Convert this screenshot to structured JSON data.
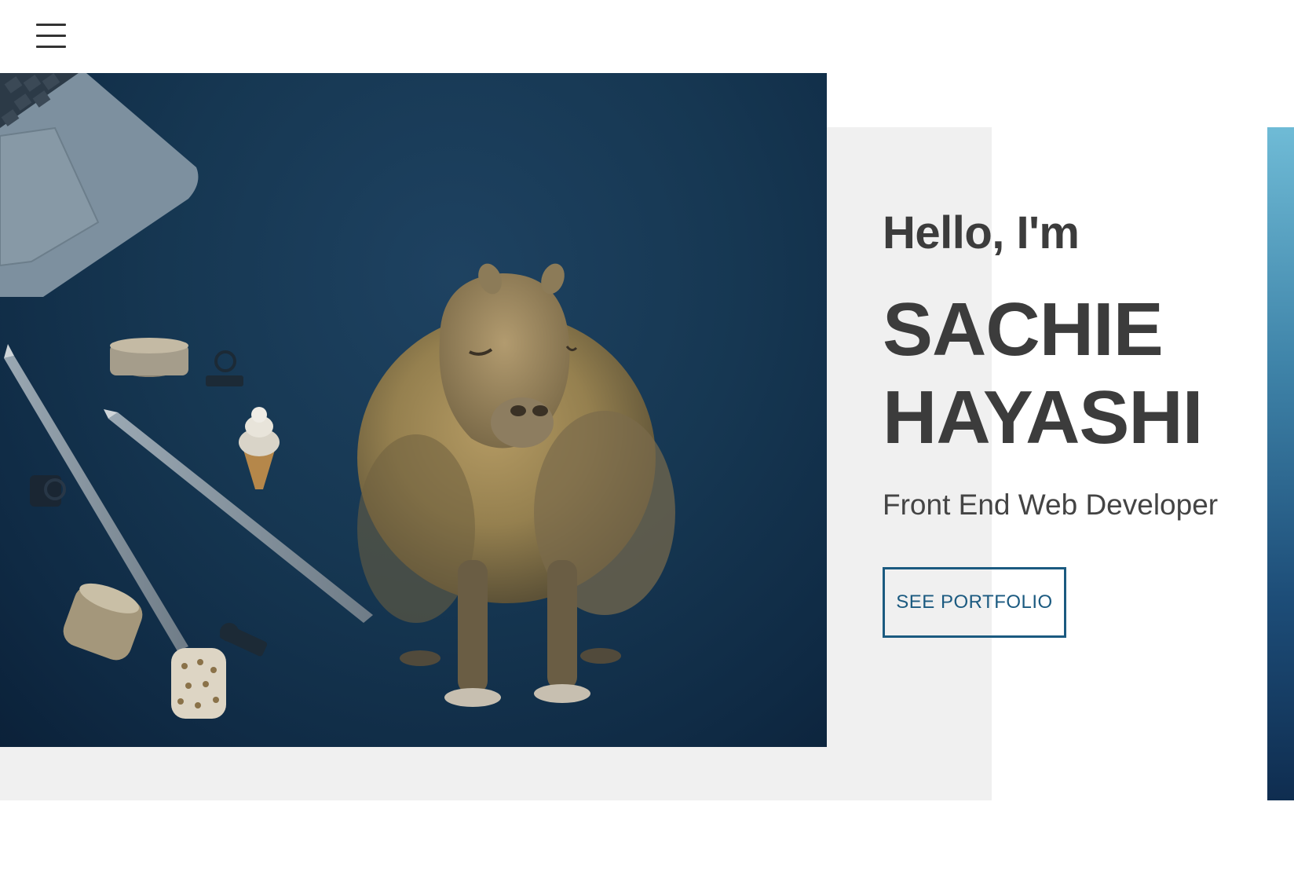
{
  "header": {
    "menu_icon": "hamburger-menu-icon"
  },
  "intro": {
    "greeting": "Hello, I'm",
    "name_line1": "SACHIE",
    "name_line2": "HAYASHI",
    "role": "Front End Web Developer",
    "cta_label": "SEE PORTFOLIO"
  },
  "hero_image": {
    "subject": "capybara on desk with laptop, pencils, tape and clips",
    "background_color": "#163752"
  },
  "colors": {
    "accent": "#1b5a80",
    "text": "#3c3c3c",
    "panel_gray": "#f0f0f0"
  }
}
